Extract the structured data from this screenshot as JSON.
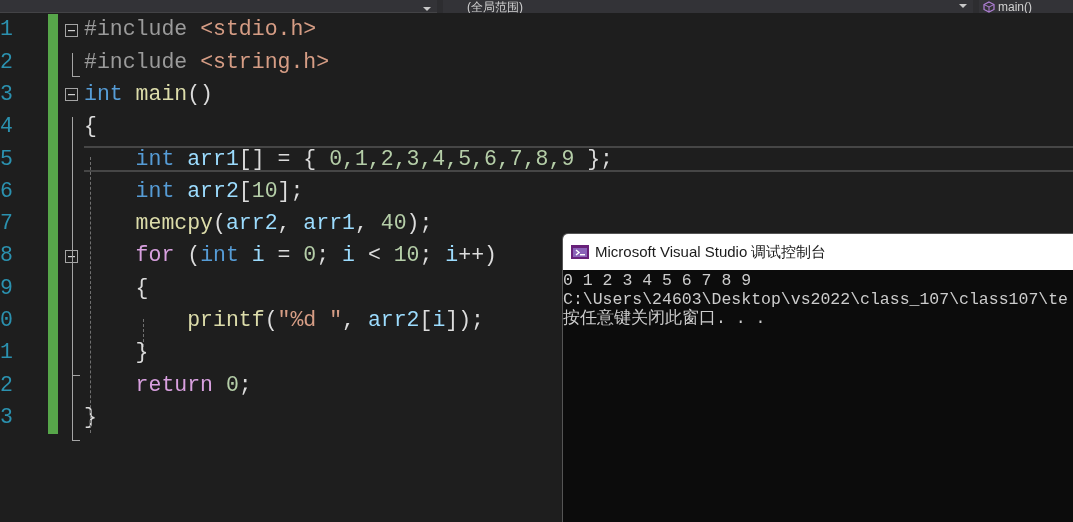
{
  "navigation_bar": {
    "scope_dropdown": {
      "value": "(全局范围)"
    },
    "member_dropdown": {
      "value": "main()"
    }
  },
  "editor": {
    "lines": [
      {
        "number": "1",
        "fold": true,
        "current": false,
        "tokens": [
          {
            "kind": "preproc",
            "text": "#include "
          },
          {
            "kind": "header",
            "text": "<stdio.h>"
          }
        ]
      },
      {
        "number": "2",
        "fold": false,
        "current": false,
        "tokens": [
          {
            "kind": "preproc",
            "text": "#include "
          },
          {
            "kind": "header",
            "text": "<string.h>"
          }
        ]
      },
      {
        "number": "3",
        "fold": true,
        "current": false,
        "tokens": [
          {
            "kind": "keyword",
            "text": "int "
          },
          {
            "kind": "function",
            "text": "main"
          },
          {
            "kind": "plain",
            "text": "()"
          }
        ]
      },
      {
        "number": "4",
        "fold": false,
        "current": false,
        "tokens": [
          {
            "kind": "plain",
            "text": "{"
          }
        ]
      },
      {
        "number": "5",
        "fold": false,
        "current": true,
        "tokens": [
          {
            "kind": "keyword",
            "text": "    int "
          },
          {
            "kind": "variable",
            "text": "arr1"
          },
          {
            "kind": "plain",
            "text": "[] = { "
          },
          {
            "kind": "number",
            "text": "0,1,2,3,4,5,6,7,8,9"
          },
          {
            "kind": "plain",
            "text": " };"
          }
        ]
      },
      {
        "number": "6",
        "fold": false,
        "current": false,
        "tokens": [
          {
            "kind": "keyword",
            "text": "    int "
          },
          {
            "kind": "variable",
            "text": "arr2"
          },
          {
            "kind": "plain",
            "text": "["
          },
          {
            "kind": "number",
            "text": "10"
          },
          {
            "kind": "plain",
            "text": "];"
          }
        ]
      },
      {
        "number": "7",
        "fold": false,
        "current": false,
        "tokens": [
          {
            "kind": "function",
            "text": "    memcpy"
          },
          {
            "kind": "plain",
            "text": "("
          },
          {
            "kind": "variable",
            "text": "arr2"
          },
          {
            "kind": "plain",
            "text": ", "
          },
          {
            "kind": "variable",
            "text": "arr1"
          },
          {
            "kind": "plain",
            "text": ", "
          },
          {
            "kind": "number",
            "text": "40"
          },
          {
            "kind": "plain",
            "text": ");"
          }
        ]
      },
      {
        "number": "8",
        "fold": true,
        "current": false,
        "tokens": [
          {
            "kind": "control",
            "text": "    for "
          },
          {
            "kind": "plain",
            "text": "("
          },
          {
            "kind": "keyword",
            "text": "int "
          },
          {
            "kind": "variable",
            "text": "i"
          },
          {
            "kind": "plain",
            "text": " = "
          },
          {
            "kind": "number",
            "text": "0"
          },
          {
            "kind": "plain",
            "text": "; "
          },
          {
            "kind": "variable",
            "text": "i"
          },
          {
            "kind": "plain",
            "text": " < "
          },
          {
            "kind": "number",
            "text": "10"
          },
          {
            "kind": "plain",
            "text": "; "
          },
          {
            "kind": "variable",
            "text": "i"
          },
          {
            "kind": "plain",
            "text": "++)"
          }
        ]
      },
      {
        "number": "9",
        "fold": false,
        "current": false,
        "tokens": [
          {
            "kind": "plain",
            "text": "    {"
          }
        ]
      },
      {
        "number": "0",
        "fold": false,
        "current": false,
        "tokens": [
          {
            "kind": "function",
            "text": "        printf"
          },
          {
            "kind": "plain",
            "text": "("
          },
          {
            "kind": "string",
            "text": "\"%d \""
          },
          {
            "kind": "plain",
            "text": ", "
          },
          {
            "kind": "variable",
            "text": "arr2"
          },
          {
            "kind": "plain",
            "text": "["
          },
          {
            "kind": "variable",
            "text": "i"
          },
          {
            "kind": "plain",
            "text": "]);"
          }
        ]
      },
      {
        "number": "1",
        "fold": false,
        "current": false,
        "tokens": [
          {
            "kind": "plain",
            "text": "    }"
          }
        ]
      },
      {
        "number": "2",
        "fold": false,
        "current": false,
        "tokens": [
          {
            "kind": "control",
            "text": "    return "
          },
          {
            "kind": "number",
            "text": "0"
          },
          {
            "kind": "plain",
            "text": ";"
          }
        ]
      },
      {
        "number": "3",
        "fold": false,
        "current": false,
        "tokens": [
          {
            "kind": "plain",
            "text": "}"
          }
        ]
      }
    ]
  },
  "console_window": {
    "title": "Microsoft Visual Studio 调试控制台",
    "output": [
      "0 1 2 3 4 5 6 7 8 9",
      "C:\\Users\\24603\\Desktop\\vs2022\\class_107\\class107\\te",
      "按任意键关闭此窗口. . ."
    ]
  }
}
